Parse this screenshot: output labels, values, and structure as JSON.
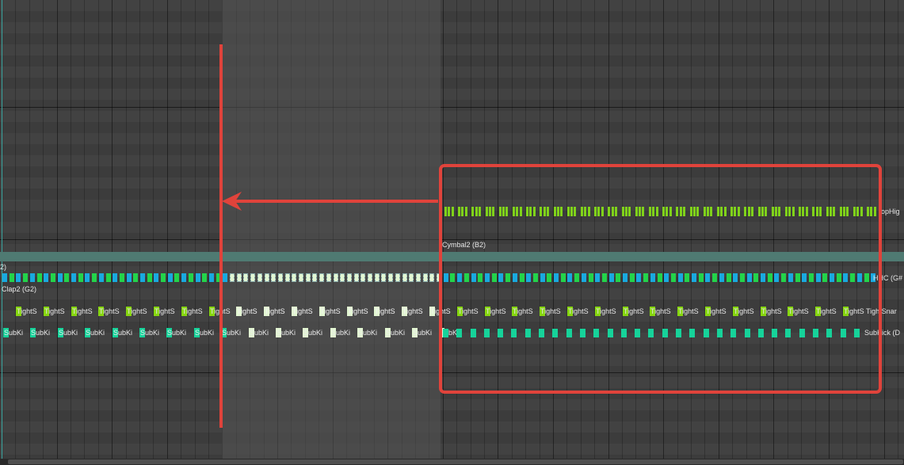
{
  "colors": {
    "background": "#3c3c3c",
    "selection_band": "#555555",
    "cymbal_lane": "#4f7a72",
    "hihat_note": "#7fd21a",
    "hat_note_blue": "#19a9e0",
    "hat_note_green": "#23d44a",
    "snare_note": "#86d60f",
    "kick_note": "#16d39a",
    "selected_note": "#e2f6d2",
    "annotation": "#e0433b"
  },
  "tracks": {
    "hihat_label": "opHig",
    "cymbal_label": "Cymbal2 (B2)",
    "chh_label": "HHC (G#",
    "left_cut_label": "2)",
    "clap_label": "Clap2 (G2)",
    "snare_note_text": "TightS",
    "snare_last_label": "TightSnar",
    "kick_note_text": "SubKi",
    "kick_last_label": "SubKick (D"
  },
  "annotation": {
    "shape_1": "highlight-box",
    "shape_2": "move-left-arrow",
    "shape_3": "insert-marker-line"
  },
  "scrollbar": {
    "label": "horizontal-scrollbar"
  }
}
